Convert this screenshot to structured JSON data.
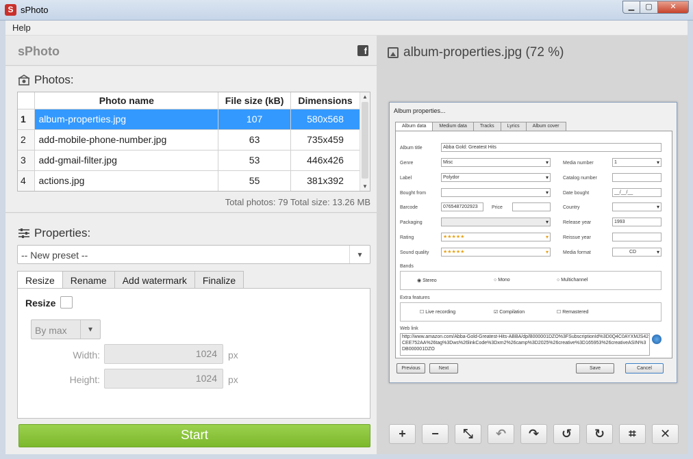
{
  "window": {
    "title": "sPhoto",
    "app_icon_letter": "S"
  },
  "menu": {
    "help": "Help"
  },
  "header": {
    "app_name": "sPhoto"
  },
  "photos": {
    "title": "Photos:",
    "columns": {
      "name": "Photo name",
      "size": "File size (kB)",
      "dims": "Dimensions"
    },
    "rows": [
      {
        "idx": "1",
        "name": "album-properties.jpg",
        "size": "107",
        "dims": "580x568"
      },
      {
        "idx": "2",
        "name": "add-mobile-phone-number.jpg",
        "size": "63",
        "dims": "735x459"
      },
      {
        "idx": "3",
        "name": "add-gmail-filter.jpg",
        "size": "53",
        "dims": "446x426"
      },
      {
        "idx": "4",
        "name": "actions.jpg",
        "size": "55",
        "dims": "381x392"
      }
    ],
    "totals": "Total photos: 79  Total size: 13.26 MB"
  },
  "properties": {
    "title": "Properties:",
    "preset": "-- New preset --",
    "tabs": {
      "resize": "Resize",
      "rename": "Rename",
      "watermark": "Add watermark",
      "finalize": "Finalize"
    },
    "resize_label": "Resize",
    "mode": "By max",
    "width_label": "Width:",
    "width_value": "1024",
    "height_label": "Height:",
    "height_value": "1024",
    "unit": "px"
  },
  "start_label": "Start",
  "preview": {
    "title": "album-properties.jpg (72 %)",
    "dialog": {
      "title": "Album properties...",
      "tabs": [
        "Album data",
        "Medium data",
        "Tracks",
        "Lyrics",
        "Album cover"
      ],
      "album_title_label": "Album title",
      "album_title_value": "Abba Gold: Greatest Hits",
      "genre_label": "Genre",
      "genre_value": "Misc",
      "label_label": "Label",
      "label_value": "Polydor",
      "bought_from_label": "Bought from",
      "barcode_label": "Barcode",
      "barcode_value": "0765487202923",
      "price_label": "Price",
      "packaging_label": "Packaging",
      "rating_label": "Rating",
      "sound_quality_label": "Sound quality",
      "stars": "★★★★★",
      "media_number_label": "Media number",
      "media_number_value": "1",
      "catalog_number_label": "Catalog number",
      "date_bought_label": "Date bought",
      "date_bought_value": "__/__/__",
      "country_label": "Country",
      "release_year_label": "Release year",
      "release_year_value": "1993",
      "reissue_year_label": "Reissue year",
      "media_format_label": "Media format",
      "media_format_value": "CD",
      "bands_label": "Bands",
      "stereo": "Stereo",
      "mono": "Mono",
      "multichannel": "Multichannel",
      "extra_label": "Extra features",
      "live": "Live recording",
      "compilation": "Compilation",
      "remastered": "Remastered",
      "weblink_label": "Web link",
      "weblink_value": "http://www.amazon.com/Abba-Gold-Greatest-Hits-ABBA/dp/B000001DZO%3FSubscriptionId%3D0Q4C0AYXMJS42CEE752AA%26tag%3Dws%26linkCode%3Dxm2%26camp%3D2025%26creative%3D165953%26creativeASIN%3DB000001DZO",
      "previous": "Previous",
      "next": "Next",
      "save": "Save",
      "cancel": "Cancel"
    }
  },
  "toolbar": {
    "add": "+",
    "remove": "−",
    "fit": "⤡",
    "undo": "↶",
    "redo": "↷",
    "rotate_left": "↺",
    "rotate_right": "↻",
    "crop": "⌗",
    "close": "✕"
  }
}
